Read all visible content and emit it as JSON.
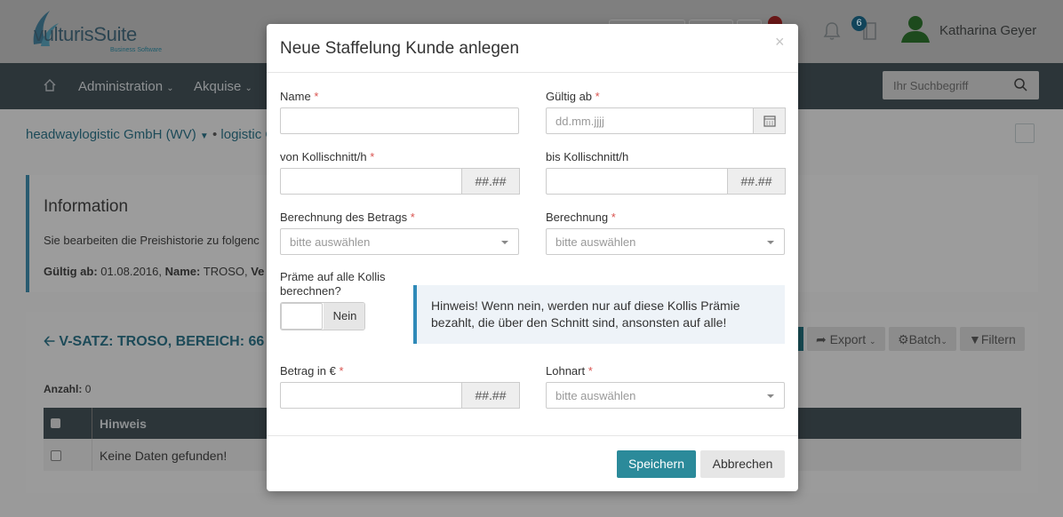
{
  "app": {
    "logo_name": "vulturisSuite",
    "logo_sub": "Business Software",
    "user_name": "Katharina Geyer",
    "notifications_count": "6"
  },
  "nav": {
    "items": [
      "Administration",
      "Akquise"
    ],
    "search_placeholder": "Ihr Suchbegriff"
  },
  "breadcrumb": {
    "company": "headwaylogistic GmbH (WV)",
    "next": "logistic C"
  },
  "info": {
    "title": "Information",
    "line1": "Sie bearbeiten die Preishistorie zu folgenc",
    "valid_label": "Gültig ab:",
    "valid_value": "01.08.2016,",
    "name_label": "Name:",
    "name_value": "TROSO,",
    "ve_text": "Ve"
  },
  "list": {
    "title": "V-SATZ: TROSO, BEREICH: 66 -",
    "count_label": "Anzahl:",
    "count_value": "0",
    "column_hint": "Hinweis",
    "empty_text": "Keine Daten gefunden!",
    "buttons": {
      "export": "Export",
      "batch": "Batch",
      "filter": "Filtern"
    }
  },
  "modal": {
    "title": "Neue Staffelung Kunde anlegen",
    "fields": {
      "name": {
        "label": "Name",
        "value": ""
      },
      "valid_from": {
        "label": "Gültig ab",
        "placeholder": "dd.mm.jjjj"
      },
      "from_avg": {
        "label": "von Kollischnitt/h",
        "addon": "##.##"
      },
      "to_avg": {
        "label": "bis Kollischnitt/h",
        "addon": "##.##"
      },
      "calc_amount": {
        "label": "Berechnung des Betrags",
        "placeholder": "bitte auswählen"
      },
      "calculation": {
        "label": "Berechnung",
        "placeholder": "bitte auswählen"
      },
      "premium_all": {
        "label_line1": "Präme auf alle Kollis",
        "label_line2": "berechnen?",
        "toggle_value": "Nein"
      },
      "amount": {
        "label": "Betrag in €",
        "addon": "##.##"
      },
      "wage_type": {
        "label": "Lohnart",
        "placeholder": "bitte auswählen"
      }
    },
    "hint_text": "Hinweis! Wenn nein, werden nur auf diese Kollis Prämie bezahlt, die über den Schnitt sind, ansonsten auf alle!",
    "save_label": "Speichern",
    "cancel_label": "Abbrechen",
    "required_mark": "*"
  },
  "colors": {
    "accent": "#2b8a9a",
    "required": "#d9534f",
    "hint_border": "#2f8ab8"
  }
}
